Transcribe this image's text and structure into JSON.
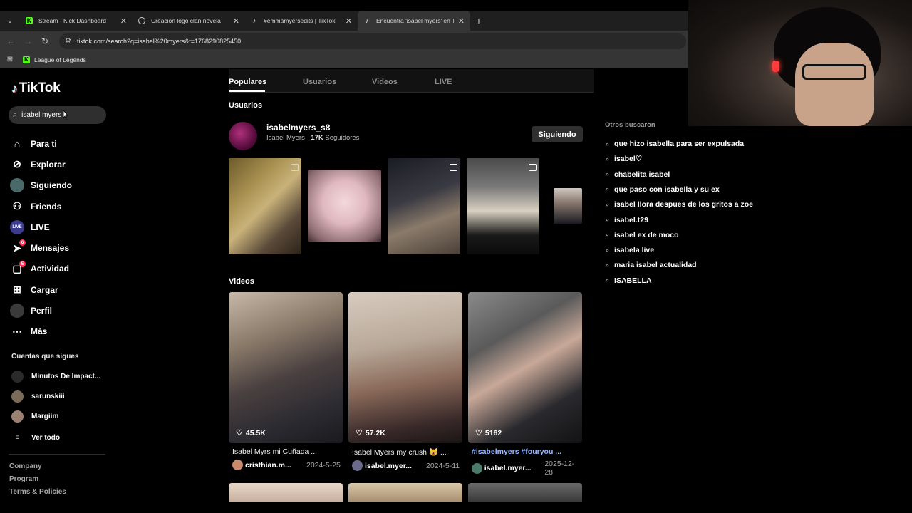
{
  "browser": {
    "tabs": [
      {
        "title": "Stream - Kick Dashboard",
        "icon": "kick-icon",
        "active": false
      },
      {
        "title": "Creación logo clan novela",
        "icon": "chatgpt-icon",
        "active": false
      },
      {
        "title": "#emmamyersedits | TikTok",
        "icon": "tiktok-icon",
        "active": false
      },
      {
        "title": "Encuentra 'isabel myers' en TikTok",
        "icon": "tiktok-icon",
        "active": true
      }
    ],
    "url": "tiktok.com/search?q=isabel%20myers&t=1768290825450",
    "bookmarks": [
      {
        "label": "League of Legends",
        "icon": "kick-icon"
      }
    ]
  },
  "tiktok": {
    "logo_text": "TikTok",
    "search_value": "isabel myers",
    "nav": [
      {
        "label": "Para ti",
        "icon": "home-icon"
      },
      {
        "label": "Explorar",
        "icon": "compass-icon"
      },
      {
        "label": "Siguiendo",
        "icon": "following-avatar-icon"
      },
      {
        "label": "Friends",
        "icon": "friends-icon"
      },
      {
        "label": "LIVE",
        "icon": "live-icon"
      },
      {
        "label": "Mensajes",
        "icon": "messages-icon",
        "badge": "6"
      },
      {
        "label": "Actividad",
        "icon": "activity-icon",
        "badge": "5"
      },
      {
        "label": "Cargar",
        "icon": "upload-icon"
      },
      {
        "label": "Perfil",
        "icon": "profile-avatar-icon"
      },
      {
        "label": "Más",
        "icon": "more-icon"
      }
    ],
    "following_title": "Cuentas que sigues",
    "following": [
      {
        "name": "Minutos De Impact..."
      },
      {
        "name": "sarunskiii"
      },
      {
        "name": "Margiim"
      }
    ],
    "see_all": "Ver todo",
    "footer": [
      "Company",
      "Program",
      "Terms & Policies"
    ]
  },
  "results": {
    "tabs": [
      "Populares",
      "Usuarios",
      "Videos",
      "LIVE"
    ],
    "users_title": "Usuarios",
    "user": {
      "username": "isabelmyers_s8",
      "display_name": "Isabel Myers",
      "followers": "17K",
      "followers_label": "Seguidores",
      "follow_button": "Siguiendo"
    },
    "videos_title": "Videos",
    "videos": [
      {
        "likes": "45.5K",
        "caption": "Isabel Myrs mi Cuñada ...",
        "author": "cristhian.m...",
        "date": "2024-5-25",
        "hashtag": false
      },
      {
        "likes": "57.2K",
        "caption": "Isabel Myers my crush 😺 ...",
        "author": "isabel.myer...",
        "date": "2024-5-11",
        "hashtag": false
      },
      {
        "likes": "5162",
        "caption": "#isabelmyers #fouryou ...",
        "author": "isabel.myer...",
        "date": "2025-12-28",
        "hashtag": true
      }
    ]
  },
  "others": {
    "title": "Otros buscaron",
    "items": [
      "que hizo isabella para ser expulsada",
      "isabel♡",
      "chabelita isabel",
      "que paso con isabella y su ex",
      "isabel llora despues de los gritos a zoe",
      "isabel.t29",
      "isabel ex de moco",
      "isabela live",
      "maria isabel actualidad",
      "ISABELLA"
    ]
  }
}
